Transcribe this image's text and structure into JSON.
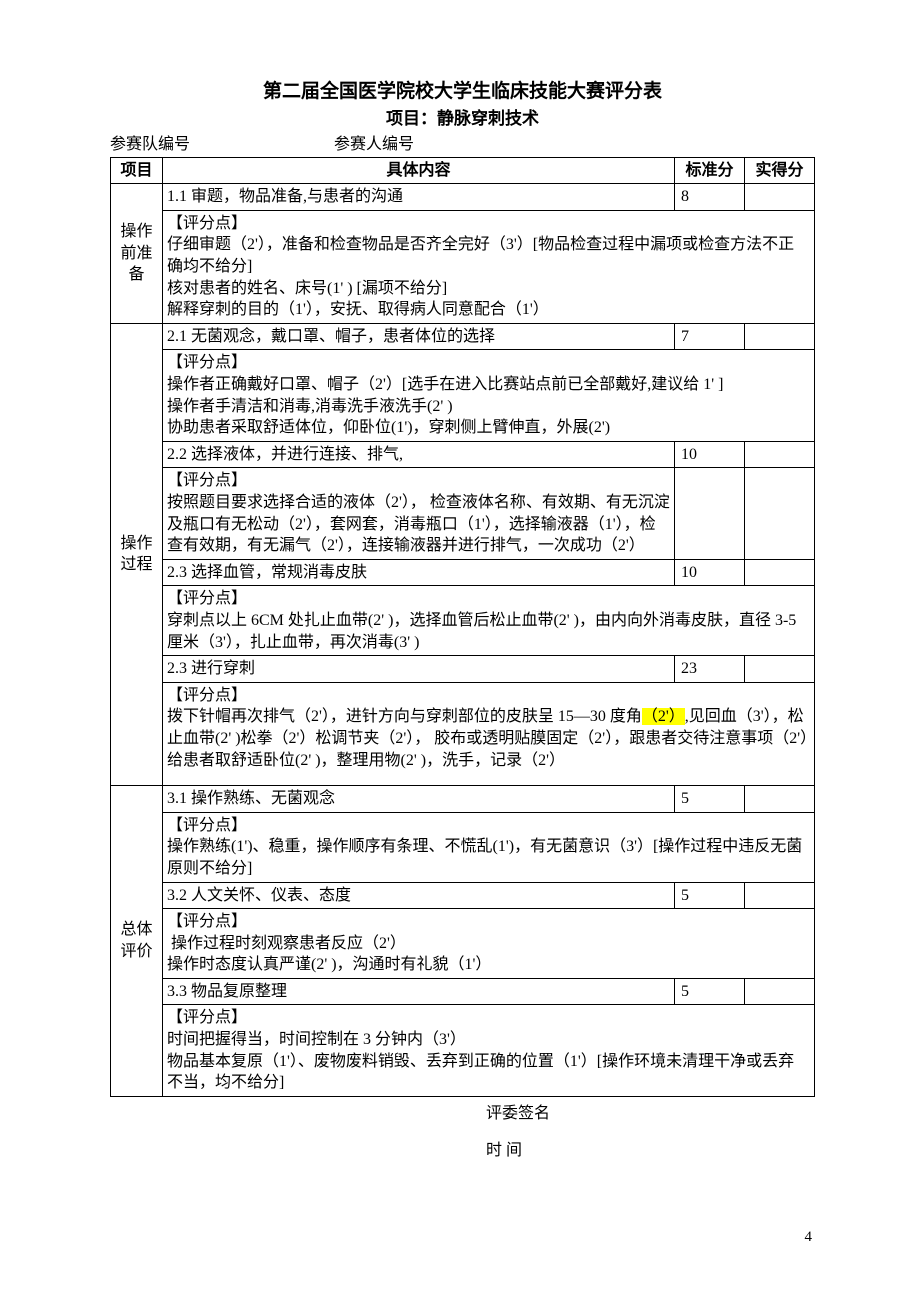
{
  "title": "第二届全国医学院校大学生临床技能大赛评分表",
  "subtitle": "项目：静脉穿刺技术",
  "ids": {
    "team": "参赛队编号",
    "person": "参赛人编号"
  },
  "head": {
    "cat": "项目",
    "content": "具体内容",
    "std": "标准分",
    "actual": "实得分"
  },
  "sec1": {
    "cat": "操作前准备",
    "r1": {
      "t": "1.1 审题，物品准备,与患者的沟通",
      "s": "8"
    },
    "r1d": "【评分点】\n仔细审题（2'），准备和检查物品是否齐全完好（3'）[物品检查过程中漏项或检查方法不正确均不给分]\n核对患者的姓名、床号(1' ) [漏项不给分]\n解释穿刺的目的（1'），安抚、取得病人同意配合（1'）"
  },
  "sec2": {
    "cat": "操作过程",
    "r1": {
      "t": "2.1 无菌观念，戴口罩、帽子，患者体位的选择",
      "s": "7"
    },
    "r1d": "【评分点】\n操作者正确戴好口罩、帽子（2'）[选手在进入比赛站点前已全部戴好,建议给 1' ]\n操作者手清洁和消毒,消毒洗手液洗手(2' )\n协助患者采取舒适体位，仰卧位(1')，穿刺侧上臂伸直，外展(2')",
    "r2": {
      "t": "2.2 选择液体，并进行连接、排气,",
      "s": "10"
    },
    "r2d": "【评分点】\n按照题目要求选择合适的液体（2'）， 检查液体名称、有效期、有无沉淀及瓶口有无松动（2'），套网套，消毒瓶口（1'），选择输液器（1'），检查有效期，有无漏气（2'），连接输液器并进行排气，一次成功（2'）",
    "r3": {
      "t": "2.3 选择血管，常规消毒皮肤",
      "s": "10"
    },
    "r3d": "【评分点】\n穿刺点以上 6CM 处扎止血带(2' )，选择血管后松止血带(2' )，由内向外消毒皮肤，直径 3-5 厘米（3'），扎止血带，再次消毒(3' )",
    "r4": {
      "t": "2.3 进行穿刺",
      "s": "23"
    },
    "r4d_a": "【评分点】\n拨下针帽再次排气（2'），进针方向与穿刺部位的皮肤呈 15—30 度角",
    "r4d_hl": "（2'）",
    "r4d_b": ",见回血（3'），松止血带(2' )松拳（2'）松调节夹（2'）， 胶布或透明贴膜固定（2'），跟患者交待注意事项（2'）给患者取舒适卧位(2' )，整理用物(2' )，洗手，记录（2'）"
  },
  "sec3": {
    "cat": "总体评价",
    "r1": {
      "t": "3.1 操作熟练、无菌观念",
      "s": "5"
    },
    "r1d": "【评分点】\n操作熟练(1')、稳重，操作顺序有条理、不慌乱(1')，有无菌意识（3'）[操作过程中违反无菌原则不给分]",
    "r2": {
      "t": "3.2 人文关怀、仪表、态度",
      "s": "5"
    },
    "r2d": "【评分点】\n 操作过程时刻观察患者反应（2'）\n操作时态度认真严谨(2' )，沟通时有礼貌（1'）",
    "r3": {
      "t": "3.3 物品复原整理",
      "s": "5"
    },
    "r3d": "【评分点】\n时间把握得当，时间控制在 3 分钟内（3'）\n物品基本复原（1'）、废物废料销毁、丢弃到正确的位置（1'）[操作环境未清理干净或丢弃不当，均不给分]"
  },
  "footer": {
    "sign": "评委签名",
    "time": "时      间"
  },
  "page": "4"
}
